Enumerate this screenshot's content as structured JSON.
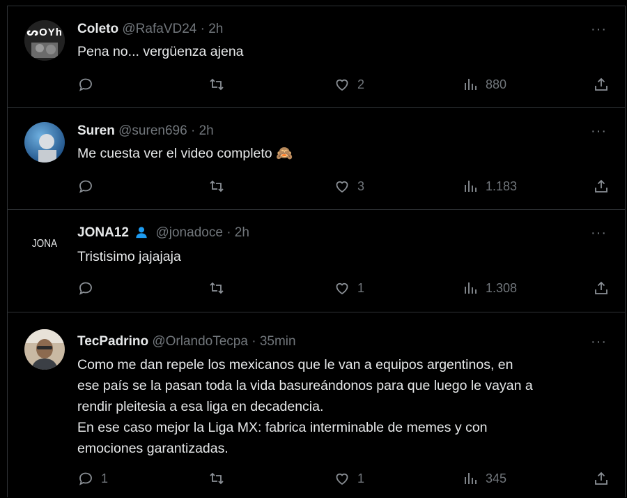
{
  "tweets": [
    {
      "name": "Coleto",
      "handle": "@RafaVD24",
      "time": "2h",
      "text": "Pena no... vergüenza ajena",
      "replies": "",
      "retweets": "",
      "likes": "2",
      "views": "880",
      "avatar_text": "ᔕOYh"
    },
    {
      "name": "Suren",
      "handle": "@suren696",
      "time": "2h",
      "text": "Me cuesta ver el video completo 🙈",
      "replies": "",
      "retweets": "",
      "likes": "3",
      "views": "1.183"
    },
    {
      "name": "JONA12",
      "handle": "@jonadoce",
      "time": "2h",
      "text": "Tristisimo jajajaja",
      "replies": "",
      "retweets": "",
      "likes": "1",
      "views": "1.308",
      "avatar_text": "JONA"
    },
    {
      "name": "TecPadrino",
      "handle": "@OrlandoTecpa",
      "time": "35min",
      "text_lines": [
        "Como me dan repele los mexicanos que le van a equipos argentinos, en",
        "ese país se la pasan toda la vida basureándonos para que luego le vayan a",
        "rendir pleitesia a esa liga en decadencia.",
        "En ese caso mejor la Liga MX: fabrica interminable de memes y con",
        "emociones garantizadas."
      ],
      "replies": "1",
      "retweets": "",
      "likes": "1",
      "views": "345"
    }
  ],
  "separator": "·",
  "more_label": "···",
  "colors": {
    "background": "#000000",
    "text": "#e7e9ea",
    "muted": "#71767b",
    "border": "#2f3336",
    "verified": "#1d9bf0"
  }
}
